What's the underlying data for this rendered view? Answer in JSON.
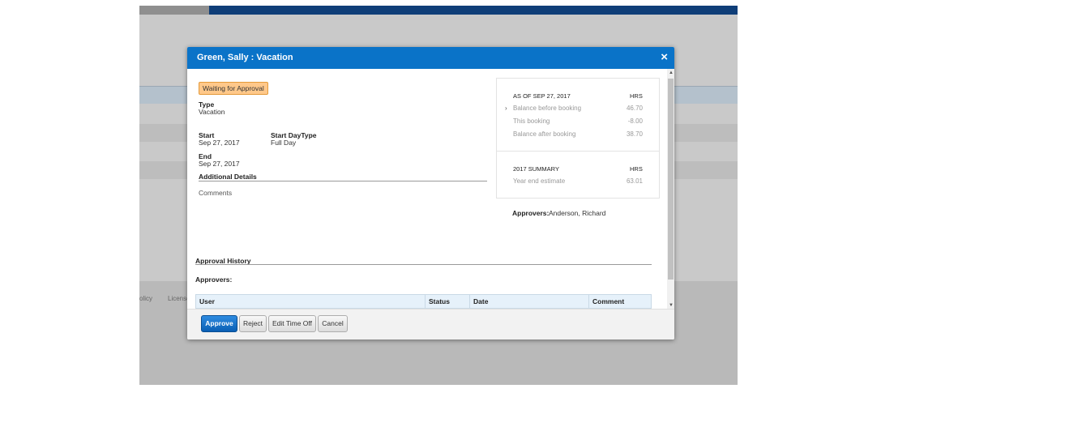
{
  "background": {
    "footer_links": [
      "olicy",
      "License"
    ]
  },
  "modal": {
    "title": "Green, Sally : Vacation",
    "close_label": "×",
    "status": "Waiting for Approval",
    "type_label": "Type",
    "type_value": "Vacation",
    "start_label": "Start",
    "start_value": "Sep 27, 2017",
    "start_daytype_label": "Start DayType",
    "start_daytype_value": "Full Day",
    "end_label": "End",
    "end_value": "Sep 27, 2017",
    "additional_details_label": "Additional Details",
    "comments_label": "Comments",
    "balance": {
      "header": "AS OF SEP 27, 2017",
      "unit": "HRS",
      "rows": [
        {
          "label": "Balance before booking",
          "value": "46.70"
        },
        {
          "label": "This booking",
          "value": "-8.00"
        },
        {
          "label": "Balance after booking",
          "value": "38.70"
        }
      ],
      "summary_header": "2017 SUMMARY",
      "summary_unit": "HRS",
      "summary_rows": [
        {
          "label": "Year end estimate",
          "value": "63.01"
        }
      ]
    },
    "approvers_label": "Approvers:",
    "approvers_value": "Anderson, Richard",
    "approval_history_label": "Approval History",
    "history_approvers_label": "Approvers:",
    "history_table": {
      "columns": [
        "User",
        "Status",
        "Date",
        "Comment"
      ]
    },
    "buttons": {
      "approve": "Approve",
      "reject": "Reject",
      "edit": "Edit Time Off",
      "cancel": "Cancel"
    }
  },
  "colors": {
    "header_blue": "#0a73c8",
    "status_badge": "#ffc88a",
    "primary_button": "#0a5fb4"
  }
}
